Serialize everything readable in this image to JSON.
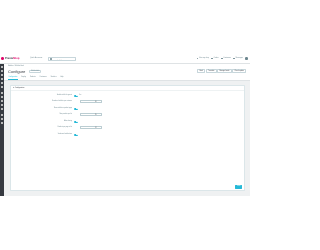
{
  "header": {
    "logo_text_1": "Presta",
    "logo_text_2": "Shop",
    "quick_access": "Quick Access ▾",
    "search_placeholder": "Search (e.g.: product reference...)",
    "items": [
      {
        "label": "View my shop"
      },
      {
        "label": "Orders"
      },
      {
        "label": "Customers"
      },
      {
        "label": "Messages"
      }
    ]
  },
  "page": {
    "breadcrumb": "Modules / Wishlist block",
    "title": "Configure",
    "badge": "Wishlist block",
    "buttons": [
      "Back",
      "Translate",
      "Manage hooks",
      "Check update"
    ],
    "tabs": [
      {
        "label": "Configuration",
        "active": true
      },
      {
        "label": "Display"
      },
      {
        "label": "Products"
      },
      {
        "label": "Customers"
      },
      {
        "label": "Statistics"
      },
      {
        "label": "Help"
      }
    ]
  },
  "panel": {
    "title": "⚙ Configuration",
    "rows": [
      {
        "label": "Enable wishlist for guests",
        "control": "switch",
        "switch_text": "Yes"
      },
      {
        "label": "Number of wishlists per customer",
        "control": "input",
        "value": "10"
      },
      {
        "label": "Show wishlist on product page",
        "control": "switch"
      },
      {
        "label": "Max products per list",
        "control": "input",
        "value": "25"
      },
      {
        "label": "Allow sharing",
        "control": "switch"
      },
      {
        "label": "Products per page in list",
        "control": "input",
        "value": "12"
      },
      {
        "label": "Send email notifications",
        "control": "switch"
      }
    ],
    "save_label": "Save"
  },
  "colors": {
    "accent": "#25b9d7",
    "brand": "#df0067",
    "sidebar": "#363a41",
    "background": "#eff1f2"
  }
}
